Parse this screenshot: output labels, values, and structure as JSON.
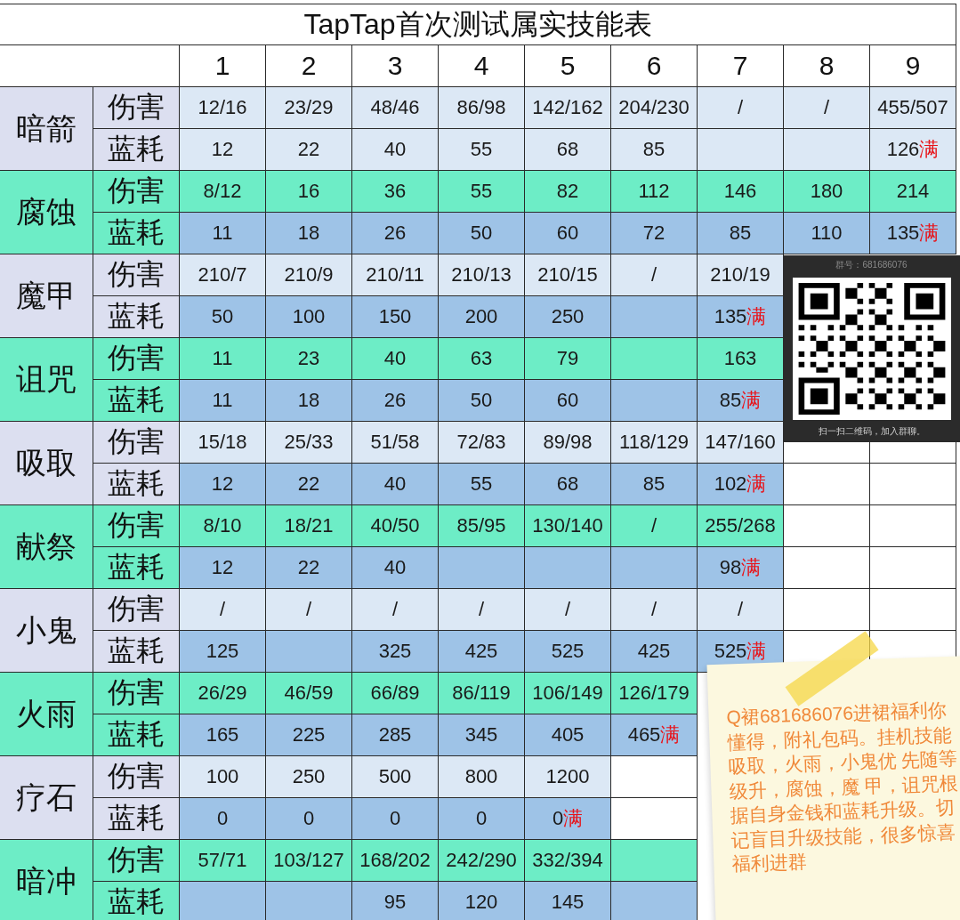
{
  "title": "TapTap首次测试属实技能表",
  "columns": [
    "1",
    "2",
    "3",
    "4",
    "5",
    "6",
    "7",
    "8",
    "9"
  ],
  "skills": [
    {
      "name": "暗箭",
      "kind": "lavender",
      "rows": [
        {
          "label": "伤害",
          "kind": "light",
          "cells": [
            {
              "text": "12/16",
              "shaded": true
            },
            {
              "text": "23/29",
              "shaded": true
            },
            {
              "text": "48/46",
              "shaded": true
            },
            {
              "text": "86/98",
              "shaded": true
            },
            {
              "text": "142/162",
              "shaded": true
            },
            {
              "text": "204/230",
              "shaded": true
            },
            {
              "text": "/",
              "shaded": true
            },
            {
              "text": "/",
              "shaded": true
            },
            {
              "text": "455/507",
              "shaded": true
            }
          ]
        },
        {
          "label": "蓝耗",
          "kind": "light",
          "cells": [
            {
              "text": "12",
              "shaded": true
            },
            {
              "text": "22",
              "shaded": true
            },
            {
              "text": "40",
              "shaded": true
            },
            {
              "text": "55",
              "shaded": true
            },
            {
              "text": "68",
              "shaded": true
            },
            {
              "text": "85",
              "shaded": true
            },
            {
              "shaded": true
            },
            {
              "shaded": true
            },
            {
              "text": "126",
              "suffix": "满",
              "shaded": true
            }
          ]
        }
      ]
    },
    {
      "name": "腐蚀",
      "kind": "green",
      "rows": [
        {
          "label": "伤害",
          "kind": "green",
          "cells": [
            {
              "text": "8/12",
              "shaded": true
            },
            {
              "text": "16",
              "shaded": true
            },
            {
              "text": "36",
              "shaded": true
            },
            {
              "text": "55",
              "shaded": true
            },
            {
              "text": "82",
              "shaded": true
            },
            {
              "text": "112",
              "shaded": true
            },
            {
              "text": "146",
              "shaded": true
            },
            {
              "text": "180",
              "shaded": true
            },
            {
              "text": "214",
              "shaded": true
            }
          ]
        },
        {
          "label": "蓝耗",
          "kind": "blue",
          "cells": [
            {
              "text": "11",
              "shaded": true
            },
            {
              "text": "18",
              "shaded": true
            },
            {
              "text": "26",
              "shaded": true
            },
            {
              "text": "50",
              "shaded": true
            },
            {
              "text": "60",
              "shaded": true
            },
            {
              "text": "72",
              "shaded": true
            },
            {
              "text": "85",
              "shaded": true
            },
            {
              "text": "110",
              "shaded": true
            },
            {
              "text": "135",
              "suffix": "满",
              "shaded": true
            }
          ]
        }
      ]
    },
    {
      "name": "魔甲",
      "kind": "lavender",
      "rows": [
        {
          "label": "伤害",
          "kind": "light",
          "cells": [
            {
              "text": "210/7",
              "shaded": true
            },
            {
              "text": "210/9",
              "shaded": true
            },
            {
              "text": "210/11",
              "shaded": true
            },
            {
              "text": "210/13",
              "shaded": true
            },
            {
              "text": "210/15",
              "shaded": true
            },
            {
              "text": "/",
              "shaded": true
            },
            {
              "text": "210/19",
              "shaded": true
            }
          ]
        },
        {
          "label": "蓝耗",
          "kind": "blue",
          "cells": [
            {
              "text": "50",
              "shaded": true
            },
            {
              "text": "100",
              "shaded": true
            },
            {
              "text": "150",
              "shaded": true
            },
            {
              "text": "200",
              "shaded": true
            },
            {
              "text": "250",
              "shaded": true
            },
            {
              "shaded": true
            },
            {
              "text": "135",
              "suffix": "满",
              "shaded": true
            }
          ]
        }
      ]
    },
    {
      "name": "诅咒",
      "kind": "green",
      "rows": [
        {
          "label": "伤害",
          "kind": "green",
          "cells": [
            {
              "text": "11",
              "shaded": true
            },
            {
              "text": "23",
              "shaded": true
            },
            {
              "text": "40",
              "shaded": true
            },
            {
              "text": "63",
              "shaded": true
            },
            {
              "text": "79",
              "shaded": true
            },
            {
              "shaded": true
            },
            {
              "text": "163",
              "shaded": true
            }
          ]
        },
        {
          "label": "蓝耗",
          "kind": "blue",
          "cells": [
            {
              "text": "11",
              "shaded": true
            },
            {
              "text": "18",
              "shaded": true
            },
            {
              "text": "26",
              "shaded": true
            },
            {
              "text": "50",
              "shaded": true
            },
            {
              "text": "60",
              "shaded": true
            },
            {
              "shaded": true
            },
            {
              "text": "85",
              "suffix": "满",
              "shaded": true
            }
          ]
        }
      ]
    },
    {
      "name": "吸取",
      "kind": "lavender",
      "rows": [
        {
          "label": "伤害",
          "kind": "light",
          "cells": [
            {
              "text": "15/18",
              "shaded": true
            },
            {
              "text": "25/33",
              "shaded": true
            },
            {
              "text": "51/58",
              "shaded": true
            },
            {
              "text": "72/83",
              "shaded": true
            },
            {
              "text": "89/98",
              "shaded": true
            },
            {
              "text": "118/129",
              "shaded": true
            },
            {
              "text": "147/160",
              "shaded": true
            },
            {
              "shaded": false
            },
            {
              "shaded": false
            }
          ]
        },
        {
          "label": "蓝耗",
          "kind": "blue",
          "cells": [
            {
              "text": "12",
              "shaded": true
            },
            {
              "text": "22",
              "shaded": true
            },
            {
              "text": "40",
              "shaded": true
            },
            {
              "text": "55",
              "shaded": true
            },
            {
              "text": "68",
              "shaded": true
            },
            {
              "text": "85",
              "shaded": true
            },
            {
              "text": "102",
              "suffix": "满",
              "shaded": true
            },
            {
              "shaded": false
            },
            {
              "shaded": false
            }
          ]
        }
      ]
    },
    {
      "name": "献祭",
      "kind": "green",
      "rows": [
        {
          "label": "伤害",
          "kind": "green",
          "cells": [
            {
              "text": "8/10",
              "shaded": true
            },
            {
              "text": "18/21",
              "shaded": true
            },
            {
              "text": "40/50",
              "shaded": true
            },
            {
              "text": "85/95",
              "shaded": true
            },
            {
              "text": "130/140",
              "shaded": true
            },
            {
              "text": "/",
              "shaded": true
            },
            {
              "text": "255/268",
              "shaded": true
            },
            {
              "shaded": false
            },
            {
              "shaded": false
            }
          ]
        },
        {
          "label": "蓝耗",
          "kind": "blue",
          "cells": [
            {
              "text": "12",
              "shaded": true
            },
            {
              "text": "22",
              "shaded": true
            },
            {
              "text": "40",
              "shaded": true
            },
            {
              "shaded": true
            },
            {
              "shaded": true
            },
            {
              "shaded": true
            },
            {
              "text": "98",
              "suffix": "满",
              "shaded": true
            },
            {
              "shaded": false
            },
            {
              "shaded": false
            }
          ]
        }
      ]
    },
    {
      "name": "小鬼",
      "kind": "lavender",
      "rows": [
        {
          "label": "伤害",
          "kind": "light",
          "cells": [
            {
              "text": "/",
              "shaded": true
            },
            {
              "text": "/",
              "shaded": true
            },
            {
              "text": "/",
              "shaded": true
            },
            {
              "text": "/",
              "shaded": true
            },
            {
              "text": "/",
              "shaded": true
            },
            {
              "text": "/",
              "shaded": true
            },
            {
              "text": "/",
              "shaded": true
            },
            {
              "shaded": false
            },
            {
              "shaded": false
            }
          ]
        },
        {
          "label": "蓝耗",
          "kind": "blue",
          "cells": [
            {
              "text": "125",
              "shaded": true
            },
            {
              "shaded": true
            },
            {
              "text": "325",
              "shaded": true
            },
            {
              "text": "425",
              "shaded": true
            },
            {
              "text": "525",
              "shaded": true
            },
            {
              "text": "425",
              "shaded": true
            },
            {
              "text": "525",
              "suffix": "满",
              "shaded": true
            },
            {
              "shaded": false
            },
            {
              "shaded": false
            }
          ]
        }
      ]
    },
    {
      "name": "火雨",
      "kind": "green",
      "rows": [
        {
          "label": "伤害",
          "kind": "green",
          "cells": [
            {
              "text": "26/29",
              "shaded": true
            },
            {
              "text": "46/59",
              "shaded": true
            },
            {
              "text": "66/89",
              "shaded": true
            },
            {
              "text": "86/119",
              "shaded": true
            },
            {
              "text": "106/149",
              "shaded": true
            },
            {
              "text": "126/179",
              "shaded": true
            }
          ]
        },
        {
          "label": "蓝耗",
          "kind": "blue",
          "cells": [
            {
              "text": "165",
              "shaded": true
            },
            {
              "text": "225",
              "shaded": true
            },
            {
              "text": "285",
              "shaded": true
            },
            {
              "text": "345",
              "shaded": true
            },
            {
              "text": "405",
              "shaded": true
            },
            {
              "text": "465",
              "suffix": "满",
              "shaded": true
            }
          ]
        }
      ]
    },
    {
      "name": "疗石",
      "kind": "lavender",
      "rows": [
        {
          "label": "伤害",
          "kind": "light",
          "cells": [
            {
              "text": "100",
              "shaded": true
            },
            {
              "text": "250",
              "shaded": true
            },
            {
              "text": "500",
              "shaded": true
            },
            {
              "text": "800",
              "shaded": true
            },
            {
              "text": "1200",
              "shaded": true
            },
            {
              "shaded": false
            }
          ]
        },
        {
          "label": "蓝耗",
          "kind": "blue",
          "cells": [
            {
              "text": "0",
              "shaded": true
            },
            {
              "text": "0",
              "shaded": true
            },
            {
              "text": "0",
              "shaded": true
            },
            {
              "text": "0",
              "shaded": true
            },
            {
              "text": "0",
              "suffix": "满",
              "shaded": true
            },
            {
              "shaded": false
            }
          ]
        }
      ]
    },
    {
      "name": "暗冲",
      "kind": "green",
      "rows": [
        {
          "label": "伤害",
          "kind": "green",
          "cells": [
            {
              "text": "57/71",
              "shaded": true
            },
            {
              "text": "103/127",
              "shaded": true
            },
            {
              "text": "168/202",
              "shaded": true
            },
            {
              "text": "242/290",
              "shaded": true
            },
            {
              "text": "332/394",
              "shaded": true
            },
            {
              "shaded": true
            }
          ]
        },
        {
          "label": "蓝耗",
          "kind": "blue",
          "cells": [
            {
              "shaded": true
            },
            {
              "shaded": true
            },
            {
              "text": "95",
              "shaded": true
            },
            {
              "text": "120",
              "shaded": true
            },
            {
              "text": "145",
              "shaded": true
            },
            {
              "shaded": true
            }
          ]
        }
      ]
    }
  ],
  "qr_card": {
    "group_number": "群号：681686076",
    "caption": "扫一扫二维码，加入群聊。"
  },
  "sticky_note": {
    "text": "Q裙681686076进裙福利你懂得，附礼包码。挂机技能吸取，火雨，小鬼优 先随等级升，腐蚀，魔 甲，诅咒根据自身金钱和蓝耗升级。切记盲目升级技能，很多惊喜福利进群"
  }
}
